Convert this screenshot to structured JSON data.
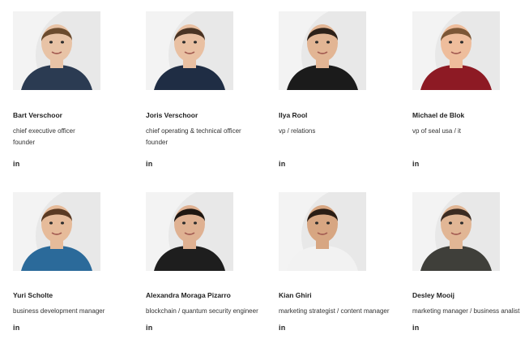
{
  "team": [
    {
      "name": "Bart Verschoor",
      "roles": [
        "chief executive officer",
        "founder"
      ],
      "social": "in",
      "photo": {
        "skin": "#e8c3a6",
        "hair": "#6b4b2e",
        "shirt": "#2b3b52"
      }
    },
    {
      "name": "Joris Verschoor",
      "roles": [
        "chief operating & technical officer",
        "founder"
      ],
      "social": "in",
      "photo": {
        "skin": "#e9c0a2",
        "hair": "#4a3424",
        "shirt": "#1f2d44"
      }
    },
    {
      "name": "Ilya Rool",
      "roles": [
        "vp / relations"
      ],
      "social": "in",
      "photo": {
        "skin": "#e2b594",
        "hair": "#2d2119",
        "shirt": "#1b1b1b"
      }
    },
    {
      "name": "Michael de Blok",
      "roles": [
        "vp of seal usa / it"
      ],
      "social": "in",
      "photo": {
        "skin": "#eebd9c",
        "hair": "#7b5636",
        "shirt": "#8d1a24"
      }
    },
    {
      "name": "Yuri Scholte",
      "roles": [
        "business development manager"
      ],
      "social": "in",
      "photo": {
        "skin": "#e6bb9a",
        "hair": "#5a3a23",
        "shirt": "#2b6a9a"
      }
    },
    {
      "name": "Alexandra Moraga Pizarro",
      "roles": [
        "blockchain / quantum security engineer"
      ],
      "social": "in",
      "photo": {
        "skin": "#dfb192",
        "hair": "#1f1712",
        "shirt": "#1e1e1e"
      }
    },
    {
      "name": "Kian Ghiri",
      "roles": [
        "marketing strategist / content manager"
      ],
      "social": "in",
      "photo": {
        "skin": "#d7a682",
        "hair": "#2a1d15",
        "shirt": "#f2f2f2"
      }
    },
    {
      "name": "Desley Mooij",
      "roles": [
        "marketing manager / business analist"
      ],
      "social": "in",
      "photo": {
        "skin": "#e1b695",
        "hair": "#3b2b21",
        "shirt": "#3f3f3a"
      }
    }
  ]
}
